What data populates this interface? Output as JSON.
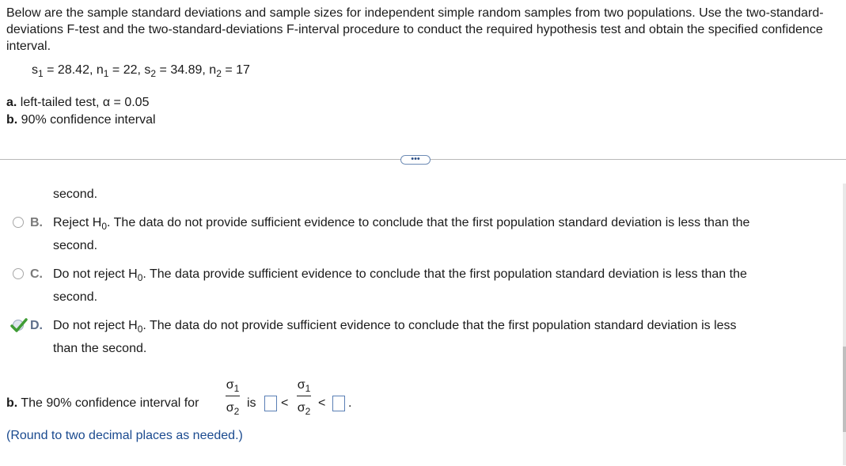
{
  "question": {
    "intro": "Below are the sample standard deviations and sample sizes for independent simple random samples from two populations. Use the two-standard-deviations F-test and the two-standard-deviations F-interval procedure to conduct the required hypothesis test and obtain the specified confidence interval.",
    "given": {
      "s1_label": "s",
      "s1_sub": "1",
      "s1_value": "= 28.42,",
      "n1_label": "n",
      "n1_sub": "1",
      "n1_value": "= 22,",
      "s2_label": "s",
      "s2_sub": "2",
      "s2_value": "= 34.89,",
      "n2_label": "n",
      "n2_sub": "2",
      "n2_value": "= 17"
    },
    "part_a_label": "a.",
    "part_a_text": "left-tailed test, α = 0.05",
    "part_b_label": "b.",
    "part_b_text": "90% confidence interval"
  },
  "more_button": "•••",
  "options": [
    {
      "continuation": "second."
    },
    {
      "letter": "B.",
      "pre": "Reject H",
      "sub": "0",
      "post": ". The data do not provide sufficient evidence to conclude that the first population standard deviation is less than the",
      "line2": "second."
    },
    {
      "letter": "C.",
      "pre": "Do not reject H",
      "sub": "0",
      "post": ". The data provide sufficient evidence to conclude that the first population standard deviation is less than the",
      "line2": "second."
    },
    {
      "letter": "D.",
      "pre": "Do not reject H",
      "sub": "0",
      "post": ". The data do not provide sufficient evidence to conclude that the first population standard deviation is less",
      "line2": "than the second."
    }
  ],
  "part_b": {
    "label": "b.",
    "text": "The 90% confidence interval for",
    "is": "is",
    "lt1": "<",
    "lt2": "<",
    "period": ".",
    "sigma": "σ",
    "sub1": "1",
    "sub2": "2",
    "hint": "(Round to two decimal places as needed.)"
  },
  "colors": {
    "correct_check": "#3f9c35",
    "hint_blue": "#1a4a8f",
    "box_border": "#5a7fb5"
  }
}
